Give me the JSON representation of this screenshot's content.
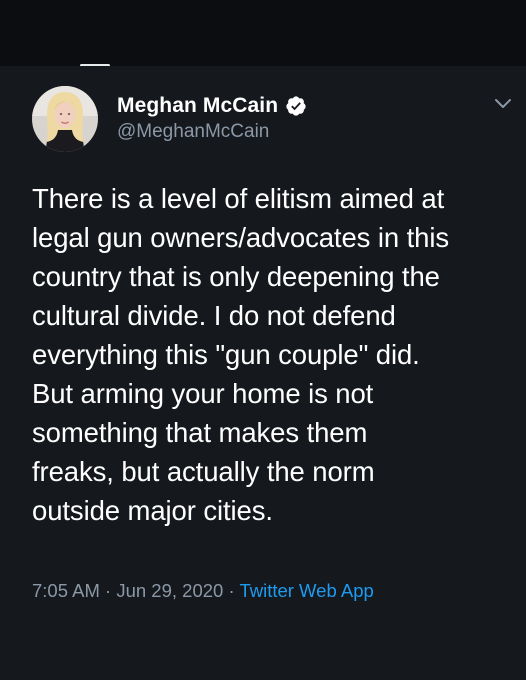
{
  "colors": {
    "background": "#15181d",
    "text": "#ffffff",
    "muted": "#8b98a5",
    "accent": "#1d9bf0",
    "verified": "#ffffff"
  },
  "tweet": {
    "display_name": "Meghan McCain",
    "handle": "@MeghanMcCain",
    "text": "There is a level of elitism aimed at\nlegal gun owners/advocates in this\ncountry that is only deepening the\ncultural divide. I do not defend\neverything this \"gun couple\" did.\nBut arming your home is not\nsomething that makes them\nfreaks, but actually the norm\noutside major cities.",
    "time": "7:05 AM",
    "separator": " · ",
    "date": "Jun 29, 2020",
    "source": "Twitter Web App",
    "icons": {
      "verified": "verified-badge-icon",
      "more": "chevron-down-icon"
    }
  }
}
